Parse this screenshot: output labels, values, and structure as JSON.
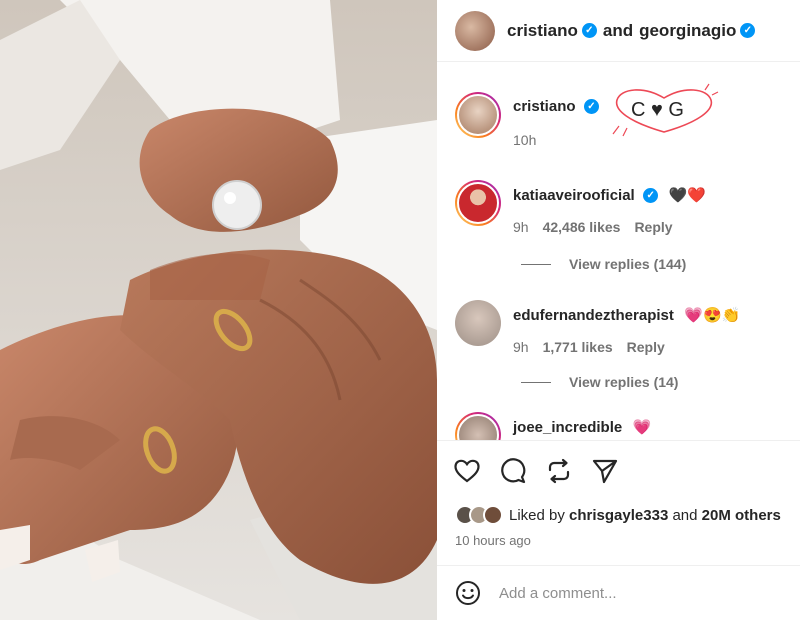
{
  "post": {
    "author": "cristiano",
    "coauthor": "georginagio",
    "joiner": "and"
  },
  "comments": [
    {
      "user": "cristiano",
      "text": "",
      "time": "10h",
      "verified": true,
      "caption_art": "C ♥ G"
    },
    {
      "user": "katiaaveirooficial",
      "text": "🖤❤️",
      "time": "9h",
      "likes": "42,486 likes",
      "reply": "Reply",
      "verified": true,
      "view_replies": "View replies (144)"
    },
    {
      "user": "edufernandeztherapist",
      "text": "💗😍👏",
      "time": "9h",
      "likes": "1,771 likes",
      "reply": "Reply",
      "verified": false,
      "view_replies": "View replies (14)"
    },
    {
      "user": "joee_incredible",
      "text": "💗",
      "verified": false
    }
  ],
  "likes": {
    "prefix": "Liked by",
    "user": "chrisgayle333",
    "joiner": "and",
    "others": "20M others"
  },
  "timestamp": "10 hours ago",
  "comment_input": {
    "placeholder": "Add a comment..."
  },
  "colors": {
    "verified": "#0095f6",
    "heart": "#ed4956",
    "muted": "#737373"
  }
}
